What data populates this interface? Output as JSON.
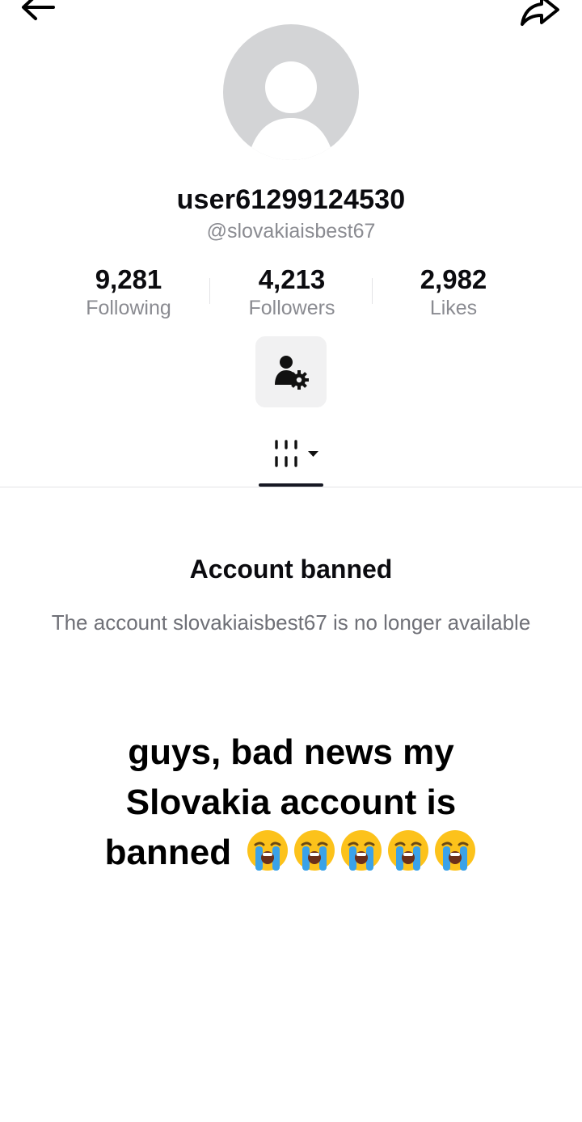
{
  "header": {
    "back_icon": "arrow-left-icon",
    "share_icon": "share-arrow-icon"
  },
  "profile": {
    "avatar_icon": "default-avatar",
    "username": "user61299124530",
    "handle": "@slovakiaisbest67"
  },
  "stats": [
    {
      "value": "9,281",
      "label": "Following"
    },
    {
      "value": "4,213",
      "label": "Followers"
    },
    {
      "value": "2,982",
      "label": "Likes"
    }
  ],
  "actions": {
    "settings_icon": "user-settings-icon"
  },
  "tabs": {
    "active_icon": "grid-filter-dropdown-icon"
  },
  "ban_notice": {
    "title": "Account banned",
    "message": "The account slovakiaisbest67 is no longer available"
  },
  "caption": {
    "text": "guys, bad news my Slovakia account is banned",
    "emoji": [
      "😭",
      "😭",
      "😭",
      "😭",
      "😭"
    ]
  },
  "colors": {
    "avatar_bg": "#d3d4d6",
    "secondary_text": "#8a8b91",
    "button_bg": "#f1f1f2"
  }
}
